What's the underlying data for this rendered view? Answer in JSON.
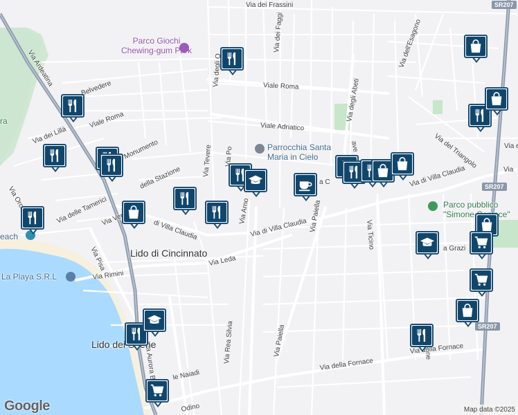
{
  "attribution": {
    "logo": "Google",
    "map_data": "Map data ©2025"
  },
  "colors": {
    "water": "#aadaff",
    "park": "#c8e6c9",
    "road": "#ffffff",
    "highway": "#8a97a8",
    "marker_bg": "#11466c",
    "marker_border": "#1b4d72"
  },
  "towns": [
    {
      "id": "lido-di-cincinnato",
      "text": "Lido di Cincinnato"
    },
    {
      "id": "lido-dei-sirene",
      "text": "Lido dei Sirene"
    }
  ],
  "pois": [
    {
      "id": "parco-giochi",
      "text": "Parco Giochi Chewing-gum Park",
      "line1": "Parco Giochi",
      "line2": "Chewing-gum Park",
      "icon": "amusement-icon"
    },
    {
      "id": "parrocchia",
      "line1": "Parrocchia Santa",
      "line2": "Maria in Cielo",
      "icon": "church-icon"
    },
    {
      "id": "parco-pubblico",
      "line1": "Parco pubblico",
      "line2": "\"Simone Coplace\"",
      "icon": "park-icon"
    },
    {
      "id": "la-playa",
      "text": "La Playa S.R.L",
      "icon": "pin-icon"
    },
    {
      "id": "beach",
      "text": "each",
      "icon": "beach-icon"
    },
    {
      "id": "ra",
      "text": "ra"
    }
  ],
  "streets": [
    {
      "id": "via-dei-frassini",
      "text": "Via dei Frassini"
    },
    {
      "id": "via-dei-faggi",
      "text": "Via dei Faggi"
    },
    {
      "id": "viale-roma-n",
      "text": "Viale Roma"
    },
    {
      "id": "viale-roma-w",
      "text": "Viale Roma"
    },
    {
      "id": "viale-adriatico",
      "text": "Viale Adriatico"
    },
    {
      "id": "via-degli-abeti",
      "text": "Via degli Abeti"
    },
    {
      "id": "via-degli-o",
      "text": "Via degli O"
    },
    {
      "id": "via-po",
      "text": "Via Po"
    },
    {
      "id": "via-tevere",
      "text": "Via Tevere"
    },
    {
      "id": "via-arno",
      "text": "Via Arno"
    },
    {
      "id": "via-ardeatina",
      "text": "Via Ardeatina"
    },
    {
      "id": "via-belvedere",
      "text": "Belvedere"
    },
    {
      "id": "via-dei-lilla",
      "text": "Via dei Lillà"
    },
    {
      "id": "monumento",
      "text": "Monumento"
    },
    {
      "id": "della-stazione",
      "text": "della Stazione"
    },
    {
      "id": "via-delle-tamerici",
      "text": "Via delle Tamerici"
    },
    {
      "id": "via-venezia",
      "text": "Via Venezi"
    },
    {
      "id": "via-orch",
      "text": "Via Orch"
    },
    {
      "id": "via-di-villa-claudia-w",
      "text": "di Villa Claudia"
    },
    {
      "id": "via-di-villa-claudia-c",
      "text": "Via di Villa Claudia"
    },
    {
      "id": "via-di-villa-claudia-e",
      "text": "Via di Villa Claudia"
    },
    {
      "id": "via-c",
      "text": "a C"
    },
    {
      "id": "via-pisa",
      "text": "Via Pisa"
    },
    {
      "id": "via-rimini",
      "text": "Via Rimini"
    },
    {
      "id": "via-leda",
      "text": "Via Leda"
    },
    {
      "id": "via-paiella-n",
      "text": "Via Paiella"
    },
    {
      "id": "via-paiella-s",
      "text": "Via Paiella"
    },
    {
      "id": "via-ticino",
      "text": "Via Ticino"
    },
    {
      "id": "via-dellesagono",
      "text": "Via dell'Esagono"
    },
    {
      "id": "via-del-triangolo",
      "text": "Via del Triangolo"
    },
    {
      "id": "via-grazie",
      "text": "a Grazi"
    },
    {
      "id": "via-aurora-boreale",
      "text": "Via Aurora Boreale"
    },
    {
      "id": "via-rea-silvia",
      "text": "Via Rea Silvia"
    },
    {
      "id": "via-della-fornace-w",
      "text": "Via della Fornace"
    },
    {
      "id": "via-della-fornace-e",
      "text": "Via della Fornace"
    },
    {
      "id": "via-delle-naiadi",
      "text": "le Naiadi"
    },
    {
      "id": "via-odino",
      "text": "Odino"
    },
    {
      "id": "via-jenne",
      "text": "Via Jenne"
    },
    {
      "id": "via-e",
      "text": "Via e"
    },
    {
      "id": "via-a",
      "text": "Via"
    },
    {
      "id": "ave",
      "text": "ave"
    }
  ],
  "road_shields": [
    {
      "id": "sr207-n",
      "text": "SR207"
    },
    {
      "id": "sr207-c",
      "text": "SR207"
    },
    {
      "id": "sr207-s",
      "text": "SR207"
    }
  ],
  "markers": [
    {
      "id": "restaurant-1",
      "icon": "restaurant-icon"
    },
    {
      "id": "restaurant-2",
      "icon": "restaurant-icon"
    },
    {
      "id": "restaurant-3",
      "icon": "restaurant-icon"
    },
    {
      "id": "restaurant-4",
      "icon": "restaurant-icon"
    },
    {
      "id": "restaurant-5",
      "icon": "restaurant-icon"
    },
    {
      "id": "restaurant-6",
      "icon": "restaurant-icon"
    },
    {
      "id": "restaurant-7",
      "icon": "restaurant-icon"
    },
    {
      "id": "restaurant-8",
      "icon": "restaurant-icon"
    },
    {
      "id": "restaurant-9",
      "icon": "restaurant-icon"
    },
    {
      "id": "restaurant-10",
      "icon": "restaurant-icon"
    },
    {
      "id": "restaurant-11",
      "icon": "restaurant-icon"
    },
    {
      "id": "restaurant-12",
      "icon": "restaurant-icon"
    },
    {
      "id": "restaurant-13",
      "icon": "restaurant-icon"
    },
    {
      "id": "restaurant-14",
      "icon": "restaurant-icon"
    },
    {
      "id": "restaurant-15",
      "icon": "restaurant-icon"
    },
    {
      "id": "school-1",
      "icon": "school-icon"
    },
    {
      "id": "school-2",
      "icon": "school-icon"
    },
    {
      "id": "school-3",
      "icon": "school-icon"
    },
    {
      "id": "cafe-1",
      "icon": "cafe-icon"
    },
    {
      "id": "shopping-1",
      "icon": "shopping-bag-icon"
    },
    {
      "id": "shopping-2",
      "icon": "shopping-bag-icon"
    },
    {
      "id": "shopping-3",
      "icon": "shopping-bag-icon"
    },
    {
      "id": "shopping-4",
      "icon": "shopping-bag-icon"
    },
    {
      "id": "shopping-5",
      "icon": "shopping-bag-icon"
    },
    {
      "id": "shopping-6",
      "icon": "shopping-bag-icon"
    },
    {
      "id": "shopping-7",
      "icon": "shopping-bag-icon"
    },
    {
      "id": "grocery-1",
      "icon": "shopping-cart-icon"
    },
    {
      "id": "grocery-2",
      "icon": "shopping-cart-icon"
    },
    {
      "id": "grocery-3",
      "icon": "shopping-cart-icon"
    }
  ]
}
